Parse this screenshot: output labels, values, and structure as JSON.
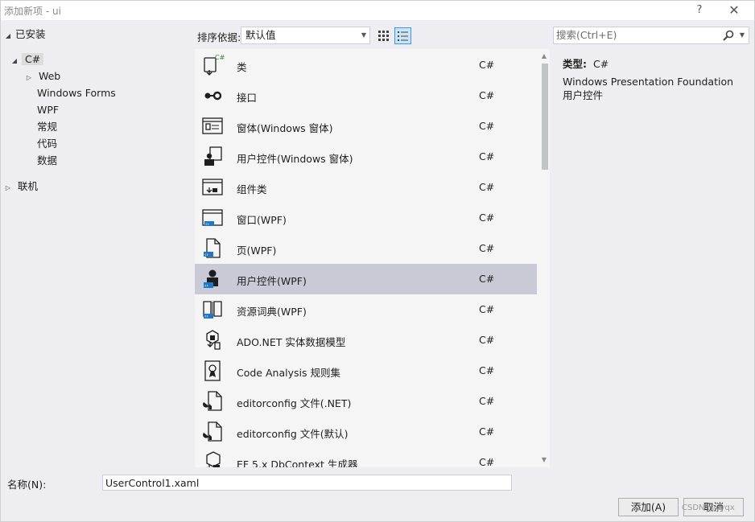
{
  "window": {
    "title": "添加新项 - ui",
    "help_label": "?",
    "close_label": "✕"
  },
  "tree": {
    "installed": "已安装",
    "csharp": "C#",
    "children": [
      "Web",
      "Windows Forms",
      "WPF",
      "常规",
      "代码",
      "数据"
    ],
    "online": "联机"
  },
  "toolbar": {
    "sort_label": "排序依据:",
    "sort_value": "默认值",
    "search_placeholder": "搜索(Ctrl+E)"
  },
  "items": [
    {
      "name": "类",
      "lang": "C#",
      "icon": "class-icon"
    },
    {
      "name": "接口",
      "lang": "C#",
      "icon": "interface-icon"
    },
    {
      "name": "窗体(Windows 窗体)",
      "lang": "C#",
      "icon": "form-icon"
    },
    {
      "name": "用户控件(Windows 窗体)",
      "lang": "C#",
      "icon": "user-control-icon"
    },
    {
      "name": "组件类",
      "lang": "C#",
      "icon": "component-icon"
    },
    {
      "name": "窗口(WPF)",
      "lang": "C#",
      "icon": "wpf-window-icon"
    },
    {
      "name": "页(WPF)",
      "lang": "C#",
      "icon": "wpf-page-icon"
    },
    {
      "name": "用户控件(WPF)",
      "lang": "C#",
      "icon": "wpf-user-control-icon",
      "selected": true
    },
    {
      "name": "资源词典(WPF)",
      "lang": "C#",
      "icon": "resource-dictionary-icon"
    },
    {
      "name": "ADO.NET 实体数据模型",
      "lang": "C#",
      "icon": "entity-model-icon"
    },
    {
      "name": "Code Analysis 规则集",
      "lang": "C#",
      "icon": "ruleset-icon"
    },
    {
      "name": "editorconfig 文件(.NET)",
      "lang": "C#",
      "icon": "editorconfig-icon"
    },
    {
      "name": "editorconfig 文件(默认)",
      "lang": "C#",
      "icon": "editorconfig-icon"
    },
    {
      "name": "EF 5.x DbContext 生成器",
      "lang": "C#",
      "icon": "dbcontext-icon"
    }
  ],
  "details": {
    "type_label": "类型:",
    "type_value": "C#",
    "description": "Windows Presentation Foundation 用户控件"
  },
  "bottom": {
    "name_label": "名称(N):",
    "name_value": "UserControl1.xaml",
    "add_button": "添加(A)",
    "cancel_button": "取消",
    "watermark": "CSDN @yyqx"
  },
  "colors": {
    "accent": "#3399ff",
    "selection": "#cacad6",
    "background": "#eeeef2"
  }
}
